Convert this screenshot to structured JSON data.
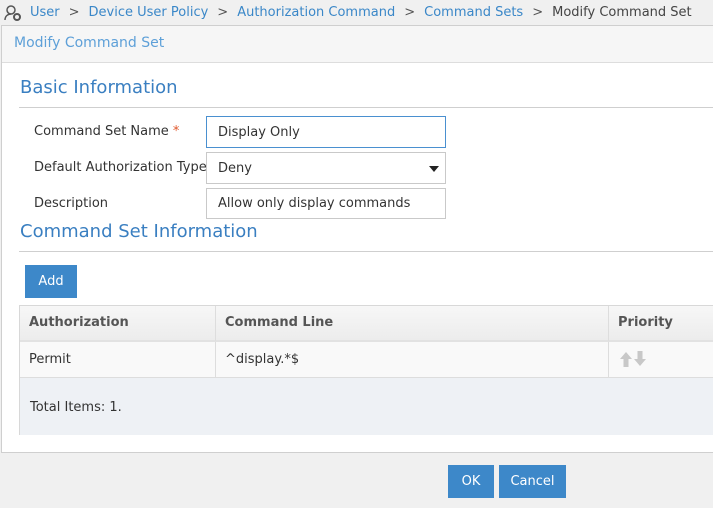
{
  "breadcrumb": {
    "items": [
      "User",
      "Device User Policy",
      "Authorization Command",
      "Command Sets"
    ],
    "current": "Modify Command Set",
    "separator": ">"
  },
  "panel": {
    "title": "Modify Command Set"
  },
  "basic": {
    "title": "Basic Information",
    "name_label": "Command Set Name",
    "required_mark": "*",
    "name_value": "Display Only",
    "type_label": "Default Authorization Type",
    "type_value": "Deny",
    "desc_label": "Description",
    "desc_value": "Allow only display commands"
  },
  "cmdset": {
    "title": "Command Set Information",
    "add_label": "Add",
    "columns": [
      "Authorization",
      "Command Line",
      "Priority"
    ],
    "rows": [
      {
        "authorization": "Permit",
        "command_line": "^display.*$"
      }
    ],
    "total": "Total Items: 1."
  },
  "footer": {
    "ok": "OK",
    "cancel": "Cancel"
  },
  "colors": {
    "accent": "#3d88c9",
    "link": "#3a87c8"
  }
}
